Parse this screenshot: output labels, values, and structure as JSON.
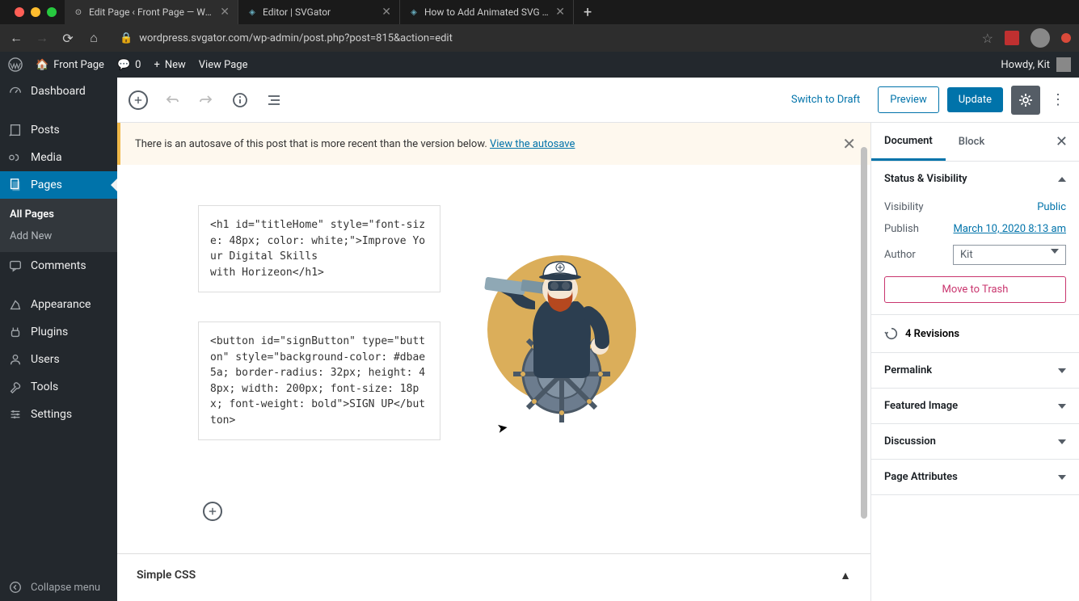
{
  "browser": {
    "tabs": [
      {
        "title": "Edit Page ‹ Front Page — WordP"
      },
      {
        "title": "Editor | SVGator"
      },
      {
        "title": "How to Add Animated SVG to W"
      }
    ],
    "url": "wordpress.svgator.com/wp-admin/post.php?post=815&action=edit"
  },
  "adminbar": {
    "site_name": "Front Page",
    "comments_count": "0",
    "new": "New",
    "view_page": "View Page",
    "howdy": "Howdy, Kit"
  },
  "sidebar": {
    "dashboard": "Dashboard",
    "posts": "Posts",
    "media": "Media",
    "pages": "Pages",
    "all_pages": "All Pages",
    "add_new": "Add New",
    "comments": "Comments",
    "appearance": "Appearance",
    "plugins": "Plugins",
    "users": "Users",
    "tools": "Tools",
    "settings": "Settings",
    "collapse": "Collapse menu"
  },
  "toolbar": {
    "switch_to_draft": "Switch to Draft",
    "preview": "Preview",
    "update": "Update"
  },
  "notice": {
    "text": "There is an autosave of this post that is more recent than the version below. ",
    "link": "View the autosave"
  },
  "blocks": {
    "code1": "<h1 id=\"titleHome\" style=\"font-size: 48px; color: white;\">Improve Your Digital Skills\nwith Horizeon</h1>",
    "code2": "<button id=\"signButton\" type=\"button\" style=\"background-color: #dbae5a; border-radius: 32px; height: 48px; width: 200px; font-size: 18px; font-weight: bold\">SIGN UP</button>"
  },
  "simple_css": "Simple CSS",
  "settings": {
    "tabs": {
      "document": "Document",
      "block": "Block"
    },
    "status": {
      "title": "Status & Visibility",
      "visibility_label": "Visibility",
      "visibility_value": "Public",
      "publish_label": "Publish",
      "publish_value": "March 10, 2020 8:13 am",
      "author_label": "Author",
      "author_value": "Kit",
      "move_trash": "Move to Trash"
    },
    "revisions_count": "4 Revisions",
    "permalink": "Permalink",
    "featured_image": "Featured Image",
    "discussion": "Discussion",
    "page_attributes": "Page Attributes"
  }
}
